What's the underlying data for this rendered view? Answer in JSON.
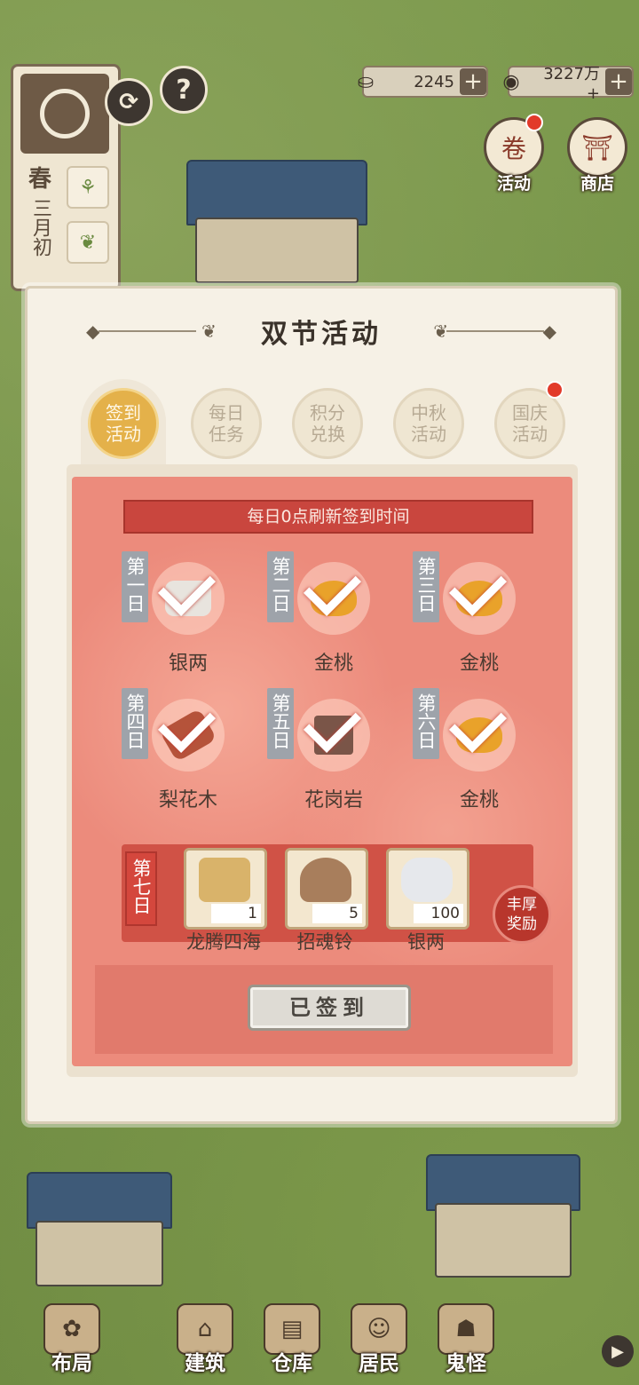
{
  "hud": {
    "season": {
      "name": "春",
      "date": "三月初"
    },
    "season_icons": [
      "sprout-icon",
      "cabbage-icon"
    ],
    "silver": {
      "value": "2245",
      "icon": "silver-ingot-icon"
    },
    "coins": {
      "value": "3227万+",
      "icon": "coin-icon"
    },
    "refresh_icon": "refresh-icon",
    "help_label": "?",
    "activity_label": "活动",
    "shop_label": "商店",
    "accent_red": "#e23a2a"
  },
  "modal": {
    "title": "双节活动",
    "tabs": [
      {
        "label": "签到活动",
        "active": true
      },
      {
        "label": "每日任务",
        "active": false
      },
      {
        "label": "积分兑换",
        "active": false
      },
      {
        "label": "中秋活动",
        "active": false
      },
      {
        "label": "国庆活动",
        "active": false,
        "badge": true
      }
    ],
    "banner": "每日0点刷新签到时间",
    "days": [
      {
        "tag": "第一日",
        "reward": "银两",
        "color": "#e8e4de",
        "signed": true
      },
      {
        "tag": "第二日",
        "reward": "金桃",
        "color": "#e9a22a",
        "signed": true
      },
      {
        "tag": "第三日",
        "reward": "金桃",
        "color": "#e9a22a",
        "signed": true
      },
      {
        "tag": "第四日",
        "reward": "梨花木",
        "color": "#b5533a",
        "signed": true
      },
      {
        "tag": "第五日",
        "reward": "花岗岩",
        "color": "#7a5548",
        "signed": true
      },
      {
        "tag": "第六日",
        "reward": "金桃",
        "color": "#e9a22a",
        "signed": true
      }
    ],
    "day7": {
      "tag": "第七日",
      "rewards": [
        {
          "name": "龙腾四海",
          "count": "1",
          "color": "#d9b36a"
        },
        {
          "name": "招魂铃",
          "count": "5",
          "color": "#a87e5c"
        },
        {
          "name": "银两",
          "count": "100",
          "color": "#e6e8ec"
        }
      ],
      "bonus_label": "丰厚奖励"
    },
    "signed_button": "已签到"
  },
  "nav": {
    "items": [
      {
        "label": "布局",
        "icon": "layout-icon"
      },
      {
        "label": "建筑",
        "icon": "building-icon"
      },
      {
        "label": "仓库",
        "icon": "warehouse-icon"
      },
      {
        "label": "居民",
        "icon": "resident-icon"
      },
      {
        "label": "鬼怪",
        "icon": "ghost-icon"
      }
    ],
    "arrow": "▶"
  }
}
